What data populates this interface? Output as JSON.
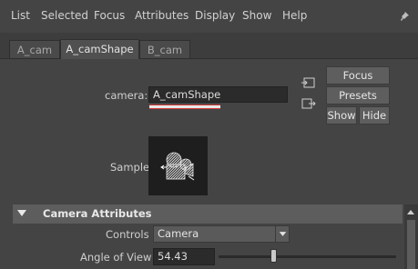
{
  "menubar": {
    "items": [
      "List",
      "Selected",
      "Focus",
      "Attributes",
      "Display",
      "Show",
      "Help"
    ],
    "pin_icon": "pin-icon"
  },
  "tabs": [
    {
      "label": "A_cam",
      "active": false
    },
    {
      "label": "A_camShape",
      "active": true
    },
    {
      "label": "B_cam",
      "active": false
    }
  ],
  "camera_row": {
    "label": "camera:",
    "value": "A_camShape",
    "left_icons": [
      "input-connection-icon",
      "output-connection-icon"
    ]
  },
  "buttons": {
    "focus": "Focus",
    "presets": "Presets",
    "show": "Show",
    "hide": "Hide"
  },
  "sample": {
    "label": "Sample",
    "icon": "camera-swatch-icon"
  },
  "section": {
    "title": "Camera Attributes",
    "expanded": true
  },
  "controls": {
    "label": "Controls",
    "value": "Camera"
  },
  "angle_of_view": {
    "label": "Angle of View",
    "value": "54.43",
    "slider_fraction": 0.3
  },
  "colors": {
    "accent_underline": "#d23a3a",
    "panel_bg": "#444444",
    "section_bg": "#5d5d5d"
  }
}
